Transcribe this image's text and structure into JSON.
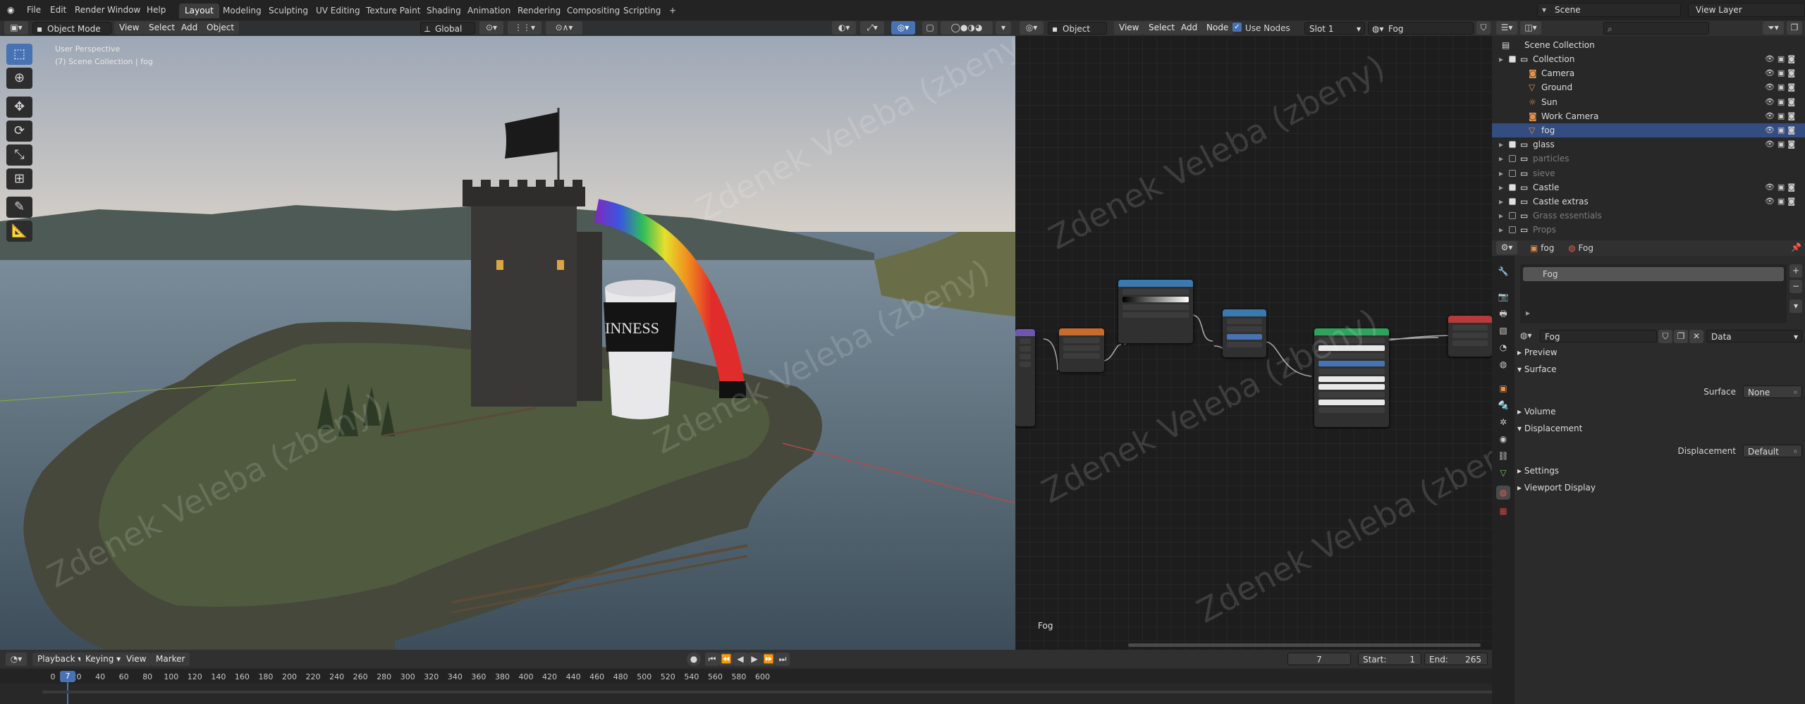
{
  "topbar": {
    "menus": [
      "File",
      "Edit",
      "Render",
      "Window",
      "Help"
    ],
    "workspaces": [
      "Layout",
      "Modeling",
      "Sculpting",
      "UV Editing",
      "Texture Paint",
      "Shading",
      "Animation",
      "Rendering",
      "Compositing",
      "Scripting"
    ],
    "active_workspace": "Layout",
    "add_tab": "+",
    "scene": "Scene",
    "view_layer": "View Layer"
  },
  "viewport": {
    "mode": "Object Mode",
    "menus": [
      "View",
      "Select",
      "Add",
      "Object"
    ],
    "orientation": "Global",
    "overlay_title": "User Perspective",
    "overlay_sub": "(7) Scene Collection | fog",
    "watermark": "Zdenek Veleba (zbeny)"
  },
  "node_editor": {
    "type": "Object",
    "menus": [
      "View",
      "Select",
      "Add",
      "Node"
    ],
    "use_nodes": "Use Nodes",
    "slot": "Slot 1",
    "material": "Fog",
    "footer_label": "Fog"
  },
  "outliner": {
    "root": "Scene Collection",
    "items": [
      {
        "name": "Collection",
        "indent": 1,
        "checked": true,
        "icon": "collection-icon",
        "dim": false
      },
      {
        "name": "Camera",
        "indent": 2,
        "checked": false,
        "icon": "camera-icon",
        "dim": false
      },
      {
        "name": "Ground",
        "indent": 2,
        "checked": false,
        "icon": "mesh-icon",
        "dim": false
      },
      {
        "name": "Sun",
        "indent": 2,
        "checked": false,
        "icon": "light-icon",
        "dim": false
      },
      {
        "name": "Work Camera",
        "indent": 2,
        "checked": false,
        "icon": "camera-icon",
        "dim": false
      },
      {
        "name": "fog",
        "indent": 2,
        "checked": false,
        "icon": "mesh-icon",
        "dim": false,
        "selected": true
      },
      {
        "name": "glass",
        "indent": 1,
        "checked": true,
        "icon": "collection-icon",
        "dim": false
      },
      {
        "name": "particles",
        "indent": 1,
        "checked": false,
        "icon": "collection-icon",
        "dim": true
      },
      {
        "name": "sieve",
        "indent": 1,
        "checked": false,
        "icon": "collection-icon",
        "dim": true
      },
      {
        "name": "Castle",
        "indent": 1,
        "checked": true,
        "icon": "collection-icon",
        "dim": false
      },
      {
        "name": "Castle extras",
        "indent": 1,
        "checked": true,
        "icon": "collection-icon",
        "dim": false
      },
      {
        "name": "Grass essentials",
        "indent": 1,
        "checked": false,
        "icon": "collection-icon",
        "dim": true
      },
      {
        "name": "Props",
        "indent": 1,
        "checked": false,
        "icon": "collection-icon",
        "dim": true
      }
    ]
  },
  "properties": {
    "object": "fog",
    "material": "Fog",
    "slot_name": "Fog",
    "material_field": "Fog",
    "link": "Data",
    "panels": {
      "preview": "Preview",
      "surface": "Surface",
      "surface_label": "Surface",
      "surface_value": "None",
      "volume": "Volume",
      "displacement": "Displacement",
      "displacement_label": "Displacement",
      "displacement_value": "Default",
      "settings": "Settings",
      "viewport_display": "Viewport Display"
    }
  },
  "timeline": {
    "menus": [
      "Playback",
      "Keying",
      "View",
      "Marker"
    ],
    "current_frame": "7",
    "start_label": "Start:",
    "start": "1",
    "end_label": "End:",
    "end": "265",
    "ticks": [
      "0",
      "20",
      "40",
      "60",
      "80",
      "100",
      "120",
      "140",
      "160",
      "180",
      "200",
      "220",
      "240",
      "260",
      "280",
      "300",
      "320",
      "340",
      "360",
      "380",
      "400",
      "420",
      "440",
      "460",
      "480",
      "500",
      "520",
      "540",
      "560",
      "580",
      "600"
    ]
  },
  "colors": {
    "accent": "#4772b3",
    "selected_row": "#334d80",
    "header": "#303030"
  }
}
